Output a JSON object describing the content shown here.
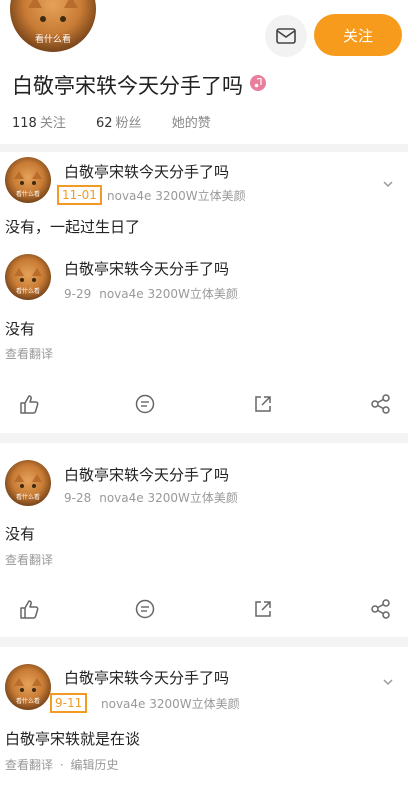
{
  "profile": {
    "avatar_caption": "看什么看",
    "name": "白敬亭宋轶今天分手了吗",
    "follow_label": "关注",
    "stats": {
      "following_count": "118",
      "following_label": "关注",
      "fans_count": "62",
      "fans_label": "粉丝",
      "likes_label": "她的赞"
    }
  },
  "posts": [
    {
      "author": "白敬亭宋轶今天分手了吗",
      "avatar_caption": "看什么看",
      "date": "11-01",
      "device": "nova4e 3200W立体美颜",
      "text": "没有，一起过生日了"
    },
    {
      "author": "白敬亭宋轶今天分手了吗",
      "avatar_caption": "看什么看",
      "date": "9-29",
      "device": "nova4e 3200W立体美颜",
      "text": "没有",
      "translate_label": "查看翻译"
    },
    {
      "author": "白敬亭宋轶今天分手了吗",
      "avatar_caption": "看什么看",
      "date": "9-28",
      "device": "nova4e 3200W立体美颜",
      "text": "没有",
      "translate_label": "查看翻译"
    },
    {
      "author": "白敬亭宋轶今天分手了吗",
      "avatar_caption": "看什么看",
      "date": "9-11",
      "device": "nova4e 3200W立体美颜",
      "text": "白敬亭宋轶就是在谈",
      "translate_label": "查看翻译",
      "separator": "·",
      "edit_history_label": "编辑历史"
    }
  ],
  "colors": {
    "accent": "#f79b1c",
    "highlight_box": "#f29a24",
    "music_badge": "#e87e9c"
  },
  "icons": {
    "mail": "mail-icon",
    "music": "music-note-icon",
    "expand": "chevron-down-icon",
    "like": "thumbs-up-icon",
    "comment": "comment-icon",
    "repost": "share-arrow-icon",
    "share": "share-nodes-icon"
  }
}
